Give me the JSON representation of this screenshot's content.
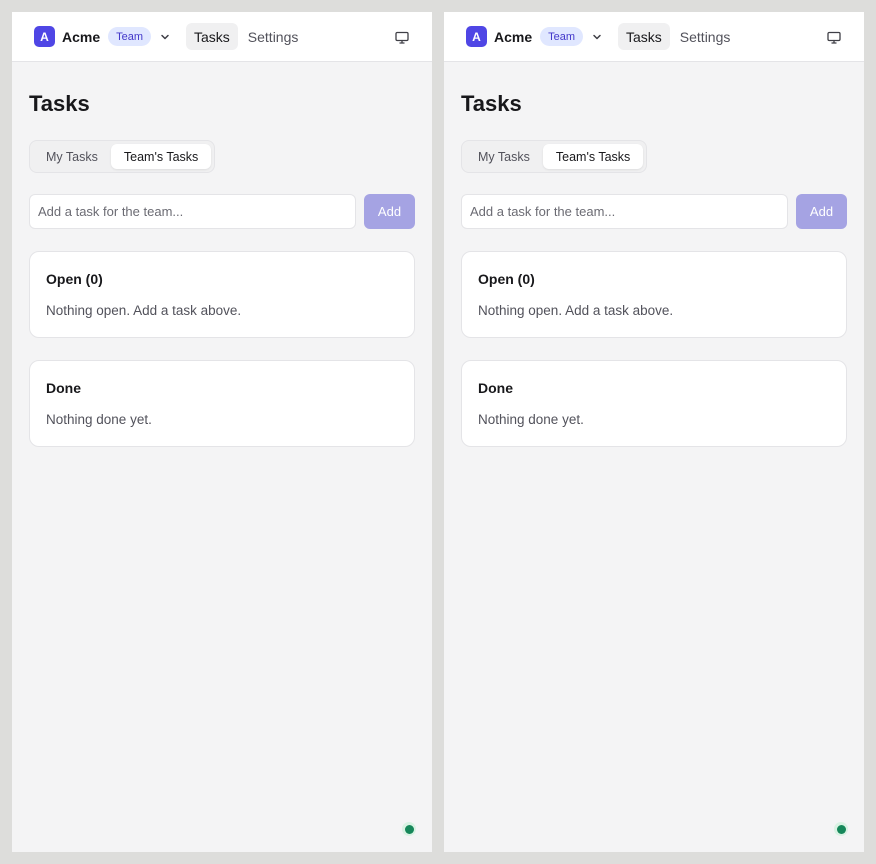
{
  "panes": [
    {
      "header": {
        "logo_letter": "A",
        "org_name": "Acme",
        "org_badge": "Team",
        "nav": [
          {
            "label": "Tasks",
            "active": true
          },
          {
            "label": "Settings",
            "active": false
          }
        ]
      },
      "main": {
        "title": "Tasks",
        "tabs": [
          {
            "label": "My Tasks",
            "active": false
          },
          {
            "label": "Team's Tasks",
            "active": true
          }
        ],
        "add_task": {
          "placeholder": "Add a task for the team...",
          "value": "",
          "button_label": "Add"
        },
        "sections": [
          {
            "title": "Open (0)",
            "empty_text": "Nothing open. Add a task above."
          },
          {
            "title": "Done",
            "empty_text": "Nothing done yet."
          }
        ]
      }
    },
    {
      "header": {
        "logo_letter": "A",
        "org_name": "Acme",
        "org_badge": "Team",
        "nav": [
          {
            "label": "Tasks",
            "active": true
          },
          {
            "label": "Settings",
            "active": false
          }
        ]
      },
      "main": {
        "title": "Tasks",
        "tabs": [
          {
            "label": "My Tasks",
            "active": false
          },
          {
            "label": "Team's Tasks",
            "active": true
          }
        ],
        "add_task": {
          "placeholder": "Add a task for the team...",
          "value": "",
          "button_label": "Add"
        },
        "sections": [
          {
            "title": "Open (0)",
            "empty_text": "Nothing open. Add a task above."
          },
          {
            "title": "Done",
            "empty_text": "Nothing done yet."
          }
        ]
      }
    }
  ],
  "icons": {
    "org_switcher": "chevron-down-icon",
    "device_toggle": "monitor-icon",
    "connection_status": "status-dot-icon"
  },
  "colors": {
    "accent": "#4f46e5",
    "add_button": "#a5a3e3",
    "badge_bg": "#e0e7ff",
    "status_online": "#16875a"
  }
}
